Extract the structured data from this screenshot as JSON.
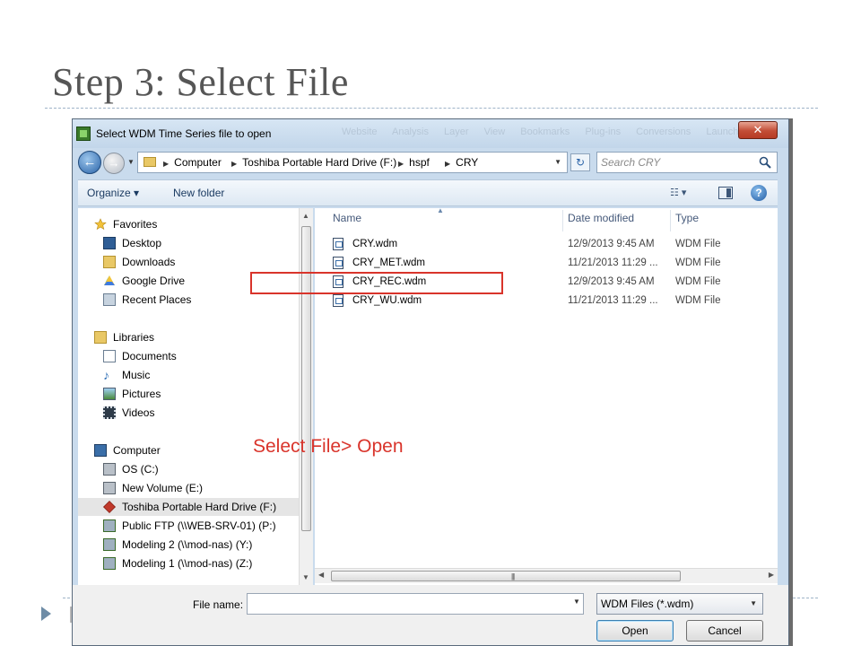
{
  "slide": {
    "title": "Step 3: Select File"
  },
  "dialog": {
    "title": "Select WDM Time Series file to open",
    "background_menu_ghost": "Website Analysis Layer View Bookmarks Plug-ins Conversions Launch",
    "close_label": "✕",
    "breadcrumb": [
      "Computer",
      "Toshiba Portable Hard Drive (F:)",
      "hspf",
      "CRY"
    ],
    "search": {
      "placeholder": "Search CRY"
    },
    "toolbar": {
      "organize_label": "Organize ▾",
      "new_folder_label": "New folder"
    },
    "nav_pane": {
      "favorites": {
        "header": "Favorites",
        "items": [
          "Desktop",
          "Downloads",
          "Google Drive",
          "Recent Places"
        ]
      },
      "libraries": {
        "header": "Libraries",
        "items": [
          "Documents",
          "Music",
          "Pictures",
          "Videos"
        ]
      },
      "computer": {
        "header": "Computer",
        "items": [
          "OS (C:)",
          "New Volume (E:)",
          "Toshiba Portable Hard Drive (F:)",
          "Public FTP (\\\\WEB-SRV-01) (P:)",
          "Modeling 2 (\\\\mod-nas) (Y:)",
          "Modeling 1 (\\\\mod-nas) (Z:)"
        ],
        "selected": "Toshiba Portable Hard Drive (F:)"
      }
    },
    "columns": {
      "name": "Name",
      "date": "Date modified",
      "type": "Type"
    },
    "files": [
      {
        "name": "CRY.wdm",
        "date": "12/9/2013 9:45 AM",
        "type": "WDM File"
      },
      {
        "name": "CRY_MET.wdm",
        "date": "11/21/2013 11:29 ...",
        "type": "WDM File"
      },
      {
        "name": "CRY_REC.wdm",
        "date": "12/9/2013 9:45 AM",
        "type": "WDM File"
      },
      {
        "name": "CRY_WU.wdm",
        "date": "11/21/2013 11:29 ...",
        "type": "WDM File"
      }
    ],
    "file_name": {
      "label": "File name:",
      "value": ""
    },
    "file_type": {
      "selected": "WDM Files (*.wdm)"
    },
    "buttons": {
      "open": "Open",
      "cancel": "Cancel"
    }
  },
  "annotation": {
    "instruction": "Select File> Open",
    "highlighted_file": "CRY_REC.wdm",
    "color": "#d9342b"
  },
  "colors": {
    "title_text": "#565656",
    "dialog_frame": "#c9dbed",
    "bullet": "#6e8ca6"
  }
}
